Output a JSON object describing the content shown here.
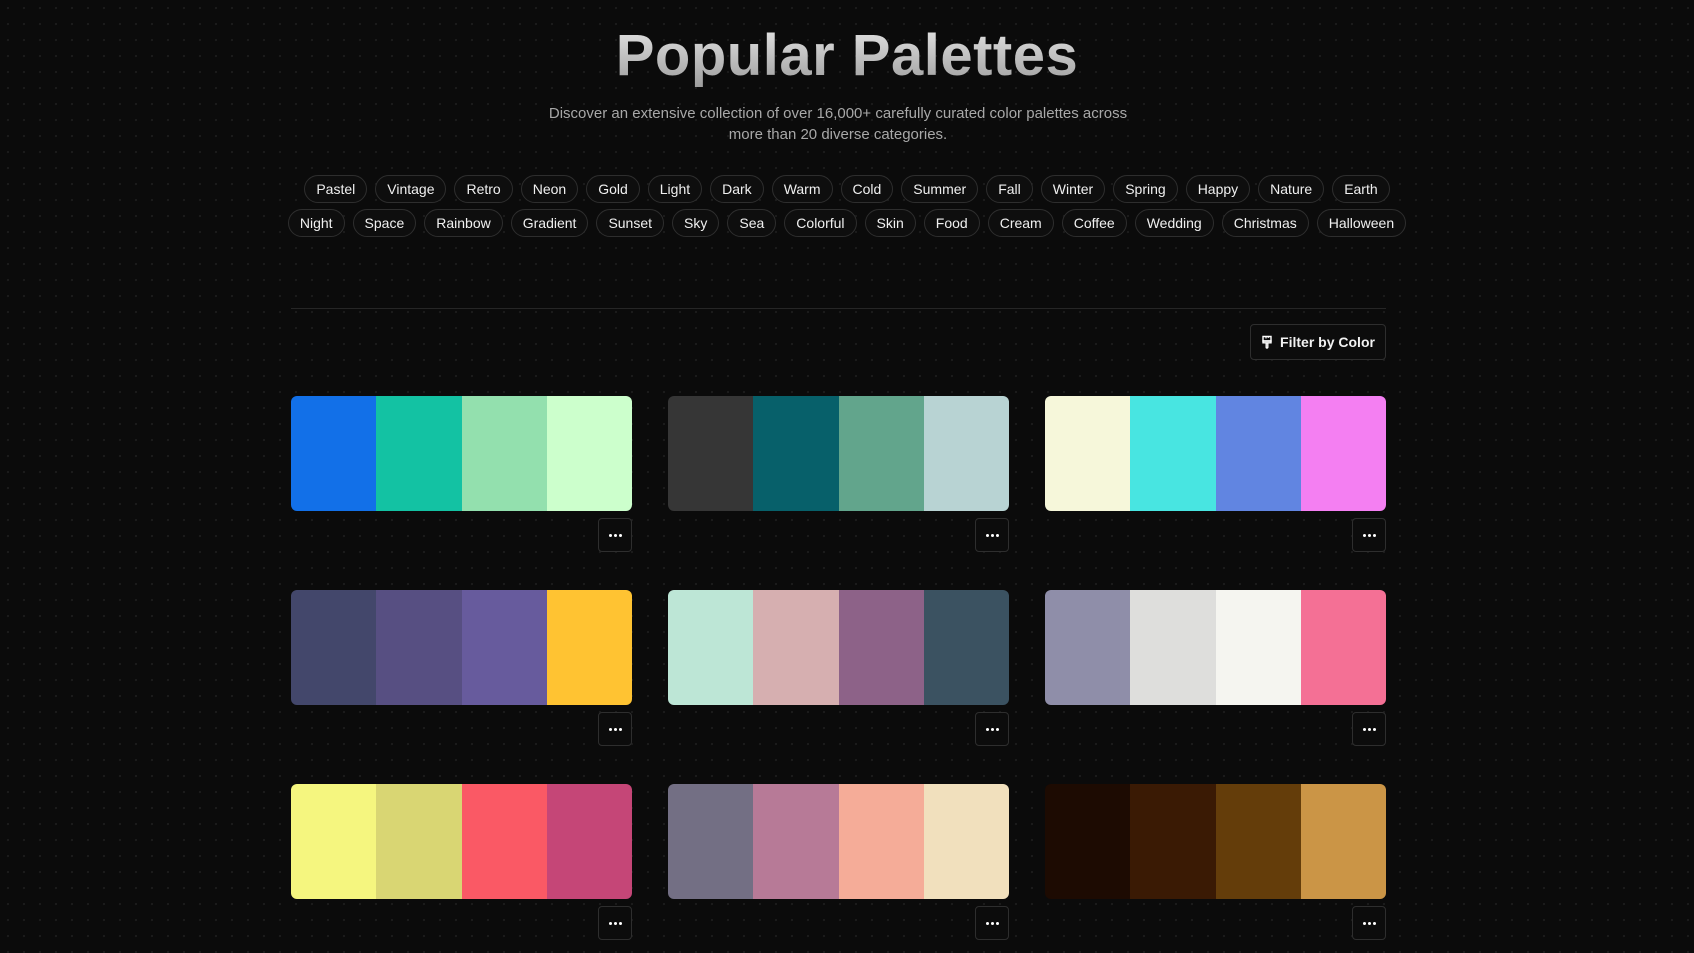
{
  "header": {
    "title": "Popular Palettes",
    "subtitle": "Discover an extensive collection of over 16,000+ carefully curated color palettes across more than 20 diverse categories."
  },
  "tags_row1": [
    "Pastel",
    "Vintage",
    "Retro",
    "Neon",
    "Gold",
    "Light",
    "Dark",
    "Warm",
    "Cold",
    "Summer",
    "Fall",
    "Winter",
    "Spring",
    "Happy",
    "Nature",
    "Earth"
  ],
  "tags_row2": [
    "Night",
    "Space",
    "Rainbow",
    "Gradient",
    "Sunset",
    "Sky",
    "Sea",
    "Colorful",
    "Skin",
    "Food",
    "Cream",
    "Coffee",
    "Wedding",
    "Christmas",
    "Halloween"
  ],
  "filter": {
    "label": "Filter by Color",
    "icon": "color-drop-icon"
  },
  "more_icon": "ellipsis-icon",
  "palettes": [
    [
      "#1270e8",
      "#13c2a3",
      "#93e0ae",
      "#ccffcc"
    ],
    [
      "#363636",
      "#07606a",
      "#62a58c",
      "#b8d3d3"
    ],
    [
      "#f6f7da",
      "#48e5e1",
      "#6185e1",
      "#f47ff2"
    ],
    [
      "#43476b",
      "#574f82",
      "#675b9d",
      "#ffc332"
    ],
    [
      "#bde6d6",
      "#d6afb0",
      "#8d6288",
      "#3b5261"
    ],
    [
      "#8f8ea9",
      "#dededc",
      "#f5f5f0",
      "#f47095"
    ],
    [
      "#f5f67f",
      "#d9d673",
      "#fa5965",
      "#c54677"
    ],
    [
      "#736f84",
      "#b77a97",
      "#f5ac98",
      "#f1e0bd"
    ],
    [
      "#1d0b02",
      "#3a1a04",
      "#643d0a",
      "#cb9546"
    ]
  ]
}
